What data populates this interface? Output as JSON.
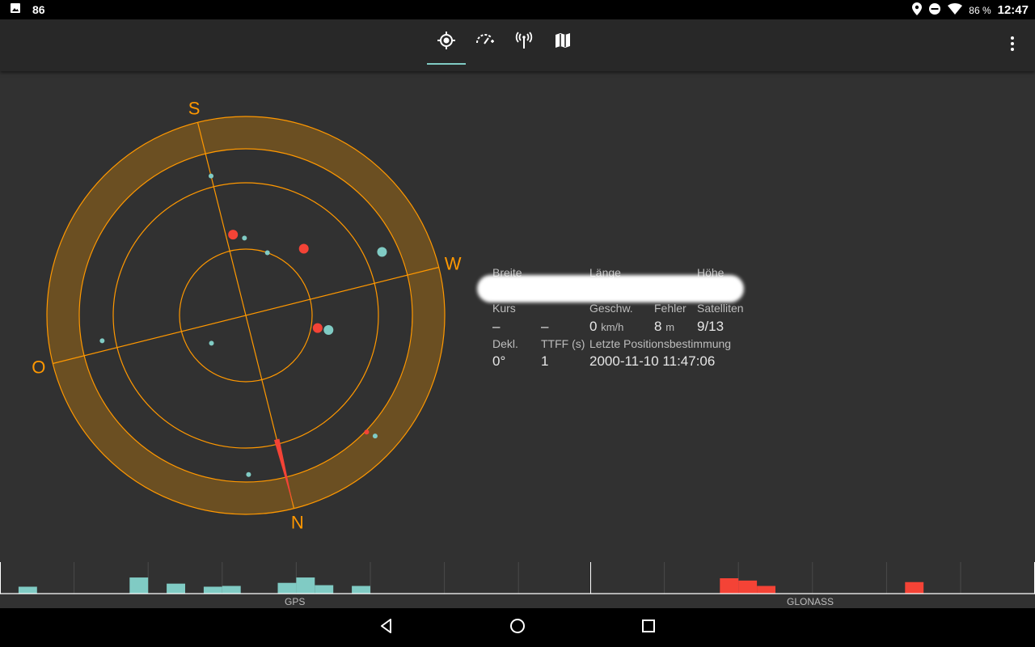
{
  "status": {
    "notification_count": "86",
    "battery": "86 %",
    "time": "12:47"
  },
  "toolbar": {
    "tabs": [
      {
        "icon": "gps-fix-icon",
        "active": true
      },
      {
        "icon": "speedometer-icon",
        "active": false
      },
      {
        "icon": "antenna-icon",
        "active": false
      },
      {
        "icon": "map-icon",
        "active": false
      }
    ],
    "overflow_icon": "more-vert-icon"
  },
  "compass": {
    "north": "N",
    "south": "S",
    "east": "O",
    "west": "W",
    "rotation_deg": 166,
    "colors": {
      "ring": "#ff9800",
      "ring_fill": "#6b4f22",
      "gps": "#80cbc4",
      "glonass": "#f44336"
    },
    "satellites": [
      {
        "system": "gps",
        "azimuth": 327,
        "elevation": 10,
        "size": "small"
      },
      {
        "system": "gps",
        "azimuth": 13,
        "elevation": 18,
        "size": "small"
      },
      {
        "system": "gps",
        "azimuth": 259,
        "elevation": 22,
        "size": "large"
      },
      {
        "system": "gps",
        "azimuth": 180,
        "elevation": 25,
        "size": "small"
      },
      {
        "system": "gps",
        "azimuth": 94,
        "elevation": 24,
        "size": "small"
      },
      {
        "system": "gps",
        "azimuth": 213,
        "elevation": 60,
        "size": "small"
      },
      {
        "system": "gps",
        "azimuth": 65,
        "elevation": 70,
        "size": "small"
      },
      {
        "system": "gps",
        "azimuth": 193,
        "elevation": 55,
        "size": "small"
      },
      {
        "system": "gps",
        "azimuth": 294,
        "elevation": 52,
        "size": "large"
      },
      {
        "system": "glonass",
        "azimuth": 185,
        "elevation": 53,
        "size": "large"
      },
      {
        "system": "glonass",
        "azimuth": 235,
        "elevation": 50,
        "size": "large"
      },
      {
        "system": "glonass",
        "azimuth": 294,
        "elevation": 57,
        "size": "large"
      },
      {
        "system": "glonass",
        "azimuth": 328,
        "elevation": 14,
        "size": "small"
      }
    ]
  },
  "info": {
    "breite_label": "Breite",
    "laenge_label": "Länge",
    "hoehe_label": "Höhe",
    "kurs_label": "Kurs",
    "geschw_label": "Geschw.",
    "fehler_label": "Fehler",
    "satelliten_label": "Satelliten",
    "kurs_value": "–",
    "kurs_value2": "–",
    "geschw_value": "0",
    "geschw_unit": "km/h",
    "fehler_value": "8",
    "fehler_unit": "m",
    "satelliten_value": "9/13",
    "dekl_label": "Dekl.",
    "ttff_label": "TTFF (s)",
    "letzte_label": "Letzte Positionsbestimmung",
    "dekl_value": "0°",
    "ttff_value": "1",
    "letzte_value": "2000-11-10 11:47:06"
  },
  "signal": {
    "gps_label": "GPS",
    "glonass_label": "GLONASS",
    "gps_bars": [
      {
        "slot": 1,
        "strength": 9
      },
      {
        "slot": 7,
        "strength": 21
      },
      {
        "slot": 9,
        "strength": 13
      },
      {
        "slot": 11,
        "strength": 9
      },
      {
        "slot": 12,
        "strength": 10
      },
      {
        "slot": 15,
        "strength": 14
      },
      {
        "slot": 16,
        "strength": 21
      },
      {
        "slot": 17,
        "strength": 11
      },
      {
        "slot": 19,
        "strength": 10
      }
    ],
    "glonass_bars": [
      {
        "slot": 7,
        "strength": 20
      },
      {
        "slot": 8,
        "strength": 17
      },
      {
        "slot": 9,
        "strength": 10
      },
      {
        "slot": 17,
        "strength": 15
      }
    ]
  },
  "nav": {
    "back_icon": "back-icon",
    "home_icon": "home-icon",
    "recents_icon": "recents-icon"
  }
}
